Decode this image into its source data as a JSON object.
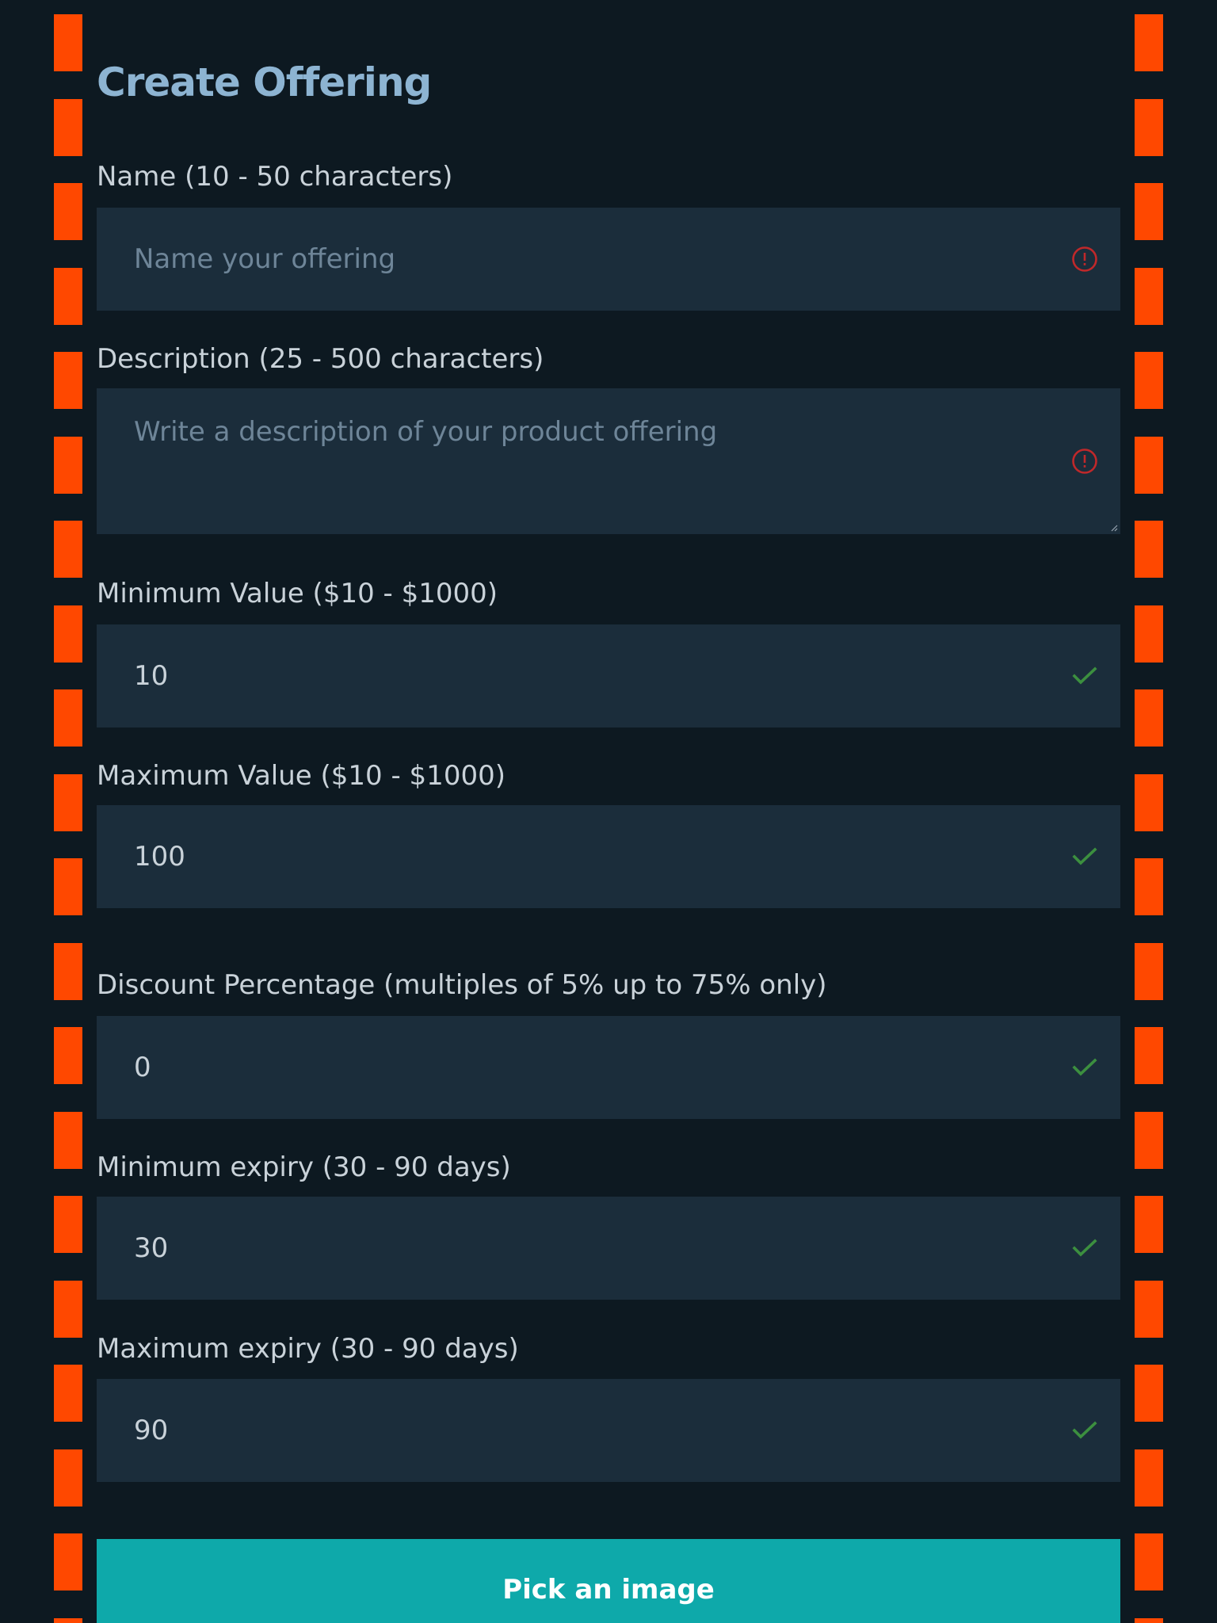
{
  "page": {
    "title": "Create Offering"
  },
  "fields": {
    "name": {
      "label": "Name (10 - 50 characters)",
      "value": "",
      "placeholder": "Name your offering",
      "status": "error"
    },
    "description": {
      "label": "Description (25 - 500 characters)",
      "value": "",
      "placeholder": "Write a description of your product offering",
      "status": "error"
    },
    "min_value": {
      "label": "Minimum Value ($10 - $1000)",
      "value": "10",
      "status": "valid"
    },
    "max_value": {
      "label": "Maximum Value ($10 - $1000)",
      "value": "100",
      "status": "valid"
    },
    "discount": {
      "label": "Discount Percentage (multiples of 5% up to 75% only)",
      "value": "0",
      "status": "valid"
    },
    "min_expiry": {
      "label": "Minimum expiry (30 - 90 days)",
      "value": "30",
      "status": "valid"
    },
    "max_expiry": {
      "label": "Maximum expiry (30 - 90 days)",
      "value": "90",
      "status": "valid"
    }
  },
  "actions": {
    "pick_image_label": "Pick an image"
  },
  "icons": {
    "error": "alert-circle-icon",
    "valid": "checkmark-icon"
  },
  "colors": {
    "background": "#0d1921",
    "border_dash": "#ff4800",
    "field_bg": "#1b2d3b",
    "title": "#8db4d2",
    "error": "#c0282a",
    "valid": "#3c8f3f",
    "button": "#0ea9aa"
  }
}
